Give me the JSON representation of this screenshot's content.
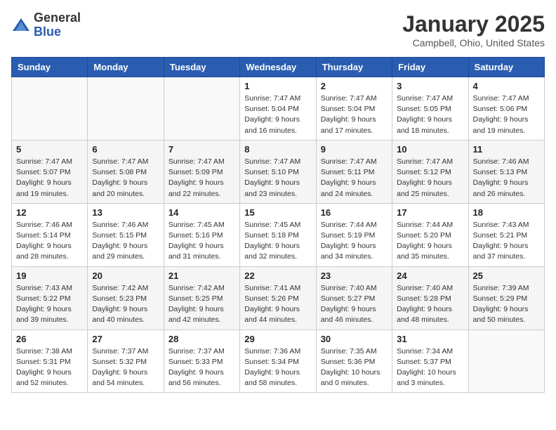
{
  "logo": {
    "general": "General",
    "blue": "Blue"
  },
  "header": {
    "month": "January 2025",
    "location": "Campbell, Ohio, United States"
  },
  "weekdays": [
    "Sunday",
    "Monday",
    "Tuesday",
    "Wednesday",
    "Thursday",
    "Friday",
    "Saturday"
  ],
  "weeks": [
    [
      {
        "day": "",
        "info": ""
      },
      {
        "day": "",
        "info": ""
      },
      {
        "day": "",
        "info": ""
      },
      {
        "day": "1",
        "info": "Sunrise: 7:47 AM\nSunset: 5:04 PM\nDaylight: 9 hours\nand 16 minutes."
      },
      {
        "day": "2",
        "info": "Sunrise: 7:47 AM\nSunset: 5:04 PM\nDaylight: 9 hours\nand 17 minutes."
      },
      {
        "day": "3",
        "info": "Sunrise: 7:47 AM\nSunset: 5:05 PM\nDaylight: 9 hours\nand 18 minutes."
      },
      {
        "day": "4",
        "info": "Sunrise: 7:47 AM\nSunset: 5:06 PM\nDaylight: 9 hours\nand 19 minutes."
      }
    ],
    [
      {
        "day": "5",
        "info": "Sunrise: 7:47 AM\nSunset: 5:07 PM\nDaylight: 9 hours\nand 19 minutes."
      },
      {
        "day": "6",
        "info": "Sunrise: 7:47 AM\nSunset: 5:08 PM\nDaylight: 9 hours\nand 20 minutes."
      },
      {
        "day": "7",
        "info": "Sunrise: 7:47 AM\nSunset: 5:09 PM\nDaylight: 9 hours\nand 22 minutes."
      },
      {
        "day": "8",
        "info": "Sunrise: 7:47 AM\nSunset: 5:10 PM\nDaylight: 9 hours\nand 23 minutes."
      },
      {
        "day": "9",
        "info": "Sunrise: 7:47 AM\nSunset: 5:11 PM\nDaylight: 9 hours\nand 24 minutes."
      },
      {
        "day": "10",
        "info": "Sunrise: 7:47 AM\nSunset: 5:12 PM\nDaylight: 9 hours\nand 25 minutes."
      },
      {
        "day": "11",
        "info": "Sunrise: 7:46 AM\nSunset: 5:13 PM\nDaylight: 9 hours\nand 26 minutes."
      }
    ],
    [
      {
        "day": "12",
        "info": "Sunrise: 7:46 AM\nSunset: 5:14 PM\nDaylight: 9 hours\nand 28 minutes."
      },
      {
        "day": "13",
        "info": "Sunrise: 7:46 AM\nSunset: 5:15 PM\nDaylight: 9 hours\nand 29 minutes."
      },
      {
        "day": "14",
        "info": "Sunrise: 7:45 AM\nSunset: 5:16 PM\nDaylight: 9 hours\nand 31 minutes."
      },
      {
        "day": "15",
        "info": "Sunrise: 7:45 AM\nSunset: 5:18 PM\nDaylight: 9 hours\nand 32 minutes."
      },
      {
        "day": "16",
        "info": "Sunrise: 7:44 AM\nSunset: 5:19 PM\nDaylight: 9 hours\nand 34 minutes."
      },
      {
        "day": "17",
        "info": "Sunrise: 7:44 AM\nSunset: 5:20 PM\nDaylight: 9 hours\nand 35 minutes."
      },
      {
        "day": "18",
        "info": "Sunrise: 7:43 AM\nSunset: 5:21 PM\nDaylight: 9 hours\nand 37 minutes."
      }
    ],
    [
      {
        "day": "19",
        "info": "Sunrise: 7:43 AM\nSunset: 5:22 PM\nDaylight: 9 hours\nand 39 minutes."
      },
      {
        "day": "20",
        "info": "Sunrise: 7:42 AM\nSunset: 5:23 PM\nDaylight: 9 hours\nand 40 minutes."
      },
      {
        "day": "21",
        "info": "Sunrise: 7:42 AM\nSunset: 5:25 PM\nDaylight: 9 hours\nand 42 minutes."
      },
      {
        "day": "22",
        "info": "Sunrise: 7:41 AM\nSunset: 5:26 PM\nDaylight: 9 hours\nand 44 minutes."
      },
      {
        "day": "23",
        "info": "Sunrise: 7:40 AM\nSunset: 5:27 PM\nDaylight: 9 hours\nand 46 minutes."
      },
      {
        "day": "24",
        "info": "Sunrise: 7:40 AM\nSunset: 5:28 PM\nDaylight: 9 hours\nand 48 minutes."
      },
      {
        "day": "25",
        "info": "Sunrise: 7:39 AM\nSunset: 5:29 PM\nDaylight: 9 hours\nand 50 minutes."
      }
    ],
    [
      {
        "day": "26",
        "info": "Sunrise: 7:38 AM\nSunset: 5:31 PM\nDaylight: 9 hours\nand 52 minutes."
      },
      {
        "day": "27",
        "info": "Sunrise: 7:37 AM\nSunset: 5:32 PM\nDaylight: 9 hours\nand 54 minutes."
      },
      {
        "day": "28",
        "info": "Sunrise: 7:37 AM\nSunset: 5:33 PM\nDaylight: 9 hours\nand 56 minutes."
      },
      {
        "day": "29",
        "info": "Sunrise: 7:36 AM\nSunset: 5:34 PM\nDaylight: 9 hours\nand 58 minutes."
      },
      {
        "day": "30",
        "info": "Sunrise: 7:35 AM\nSunset: 5:36 PM\nDaylight: 10 hours\nand 0 minutes."
      },
      {
        "day": "31",
        "info": "Sunrise: 7:34 AM\nSunset: 5:37 PM\nDaylight: 10 hours\nand 3 minutes."
      },
      {
        "day": "",
        "info": ""
      }
    ]
  ]
}
